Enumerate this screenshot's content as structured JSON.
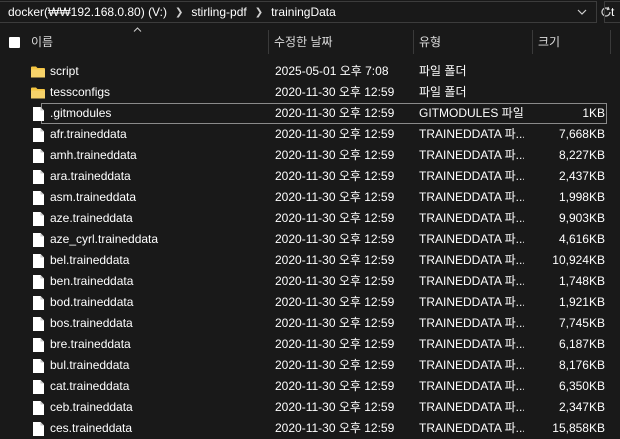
{
  "address": {
    "crumbs": [
      "docker(₩₩192.168.0.80) (V:)",
      "stirling-pdf",
      "trainingData"
    ],
    "search_value": "t"
  },
  "columns": {
    "name": "이름",
    "date": "수정한 날짜",
    "type": "유형",
    "size": "크기"
  },
  "rows": [
    {
      "name": "script",
      "date": "2025-05-01 오후 7:08",
      "type": "파일 폴더",
      "size": "",
      "kind": "folder"
    },
    {
      "name": "tessconfigs",
      "date": "2020-11-30 오후 12:59",
      "type": "파일 폴더",
      "size": "",
      "kind": "folder"
    },
    {
      "name": ".gitmodules",
      "date": "2020-11-30 오후 12:59",
      "type": "GITMODULES 파일",
      "size": "1KB",
      "kind": "file",
      "selected": true
    },
    {
      "name": "afr.traineddata",
      "date": "2020-11-30 오후 12:59",
      "type": "TRAINEDDATA 파...",
      "size": "7,668KB",
      "kind": "file"
    },
    {
      "name": "amh.traineddata",
      "date": "2020-11-30 오후 12:59",
      "type": "TRAINEDDATA 파...",
      "size": "8,227KB",
      "kind": "file"
    },
    {
      "name": "ara.traineddata",
      "date": "2020-11-30 오후 12:59",
      "type": "TRAINEDDATA 파...",
      "size": "2,437KB",
      "kind": "file"
    },
    {
      "name": "asm.traineddata",
      "date": "2020-11-30 오후 12:59",
      "type": "TRAINEDDATA 파...",
      "size": "1,998KB",
      "kind": "file"
    },
    {
      "name": "aze.traineddata",
      "date": "2020-11-30 오후 12:59",
      "type": "TRAINEDDATA 파...",
      "size": "9,903KB",
      "kind": "file"
    },
    {
      "name": "aze_cyrl.traineddata",
      "date": "2020-11-30 오후 12:59",
      "type": "TRAINEDDATA 파...",
      "size": "4,616KB",
      "kind": "file"
    },
    {
      "name": "bel.traineddata",
      "date": "2020-11-30 오후 12:59",
      "type": "TRAINEDDATA 파...",
      "size": "10,924KB",
      "kind": "file"
    },
    {
      "name": "ben.traineddata",
      "date": "2020-11-30 오후 12:59",
      "type": "TRAINEDDATA 파...",
      "size": "1,748KB",
      "kind": "file"
    },
    {
      "name": "bod.traineddata",
      "date": "2020-11-30 오후 12:59",
      "type": "TRAINEDDATA 파...",
      "size": "1,921KB",
      "kind": "file"
    },
    {
      "name": "bos.traineddata",
      "date": "2020-11-30 오후 12:59",
      "type": "TRAINEDDATA 파...",
      "size": "7,745KB",
      "kind": "file"
    },
    {
      "name": "bre.traineddata",
      "date": "2020-11-30 오후 12:59",
      "type": "TRAINEDDATA 파...",
      "size": "6,187KB",
      "kind": "file"
    },
    {
      "name": "bul.traineddata",
      "date": "2020-11-30 오후 12:59",
      "type": "TRAINEDDATA 파...",
      "size": "8,176KB",
      "kind": "file"
    },
    {
      "name": "cat.traineddata",
      "date": "2020-11-30 오후 12:59",
      "type": "TRAINEDDATA 파...",
      "size": "6,350KB",
      "kind": "file"
    },
    {
      "name": "ceb.traineddata",
      "date": "2020-11-30 오후 12:59",
      "type": "TRAINEDDATA 파...",
      "size": "2,347KB",
      "kind": "file"
    },
    {
      "name": "ces.traineddata",
      "date": "2020-11-30 오후 12:59",
      "type": "TRAINEDDATA 파...",
      "size": "15,858KB",
      "kind": "file"
    }
  ],
  "colors": {
    "folder": "#f4c542",
    "file": "#ffffff",
    "background": "#191919"
  }
}
